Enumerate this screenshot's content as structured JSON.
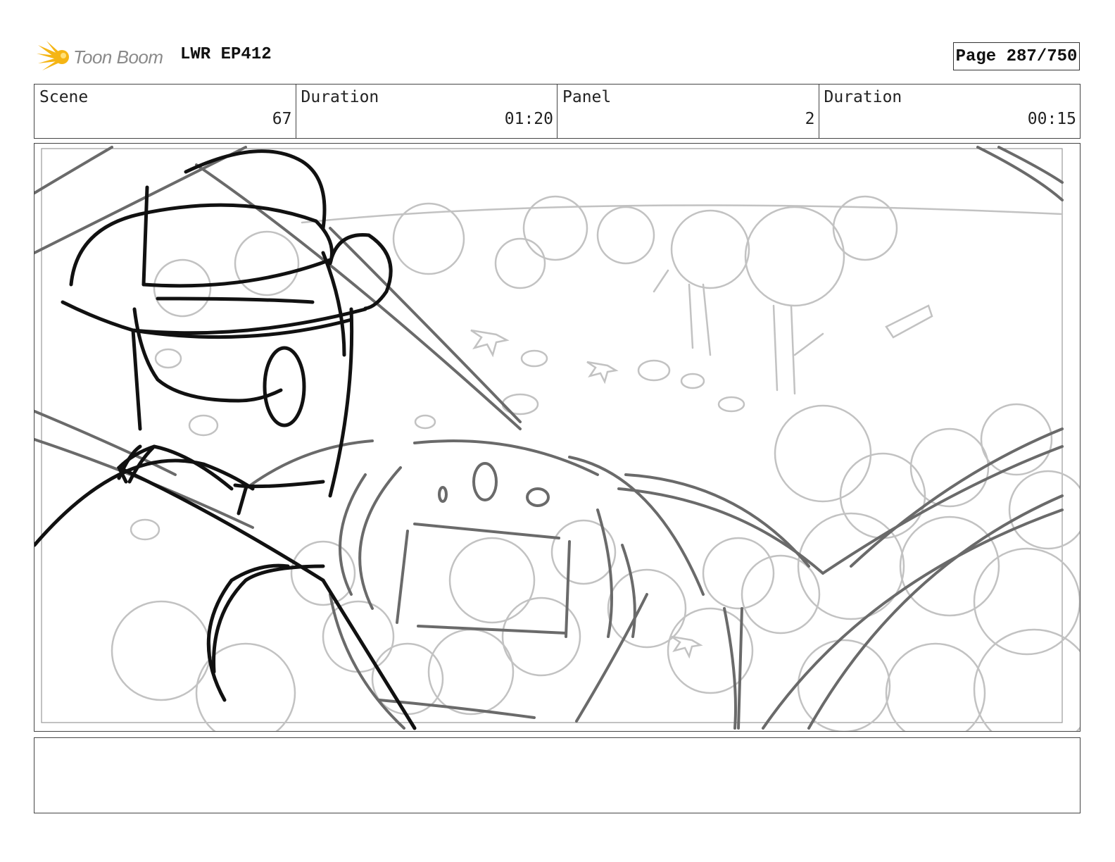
{
  "header": {
    "logo_text": "Toon Boom",
    "project_title": "LWR EP412",
    "page_label": "Page 287/750"
  },
  "info": {
    "scene_label": "Scene",
    "scene_value": "67",
    "scene_duration_label": "Duration",
    "scene_duration_value": "01:20",
    "panel_label": "Panel",
    "panel_value": "2",
    "panel_duration_label": "Duration",
    "panel_duration_value": "00:15"
  },
  "notes": {
    "text": ""
  }
}
